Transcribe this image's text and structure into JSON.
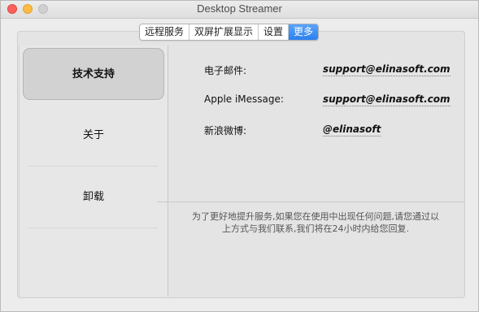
{
  "window": {
    "title": "Desktop Streamer"
  },
  "tabs": [
    {
      "label": "远程服务"
    },
    {
      "label": "双屏扩展显示"
    },
    {
      "label": "设置"
    },
    {
      "label": "更多",
      "active": true
    }
  ],
  "sidebar": {
    "items": [
      {
        "label": "技术支持",
        "selected": true
      },
      {
        "label": "关于"
      },
      {
        "label": "卸载"
      }
    ]
  },
  "support": {
    "email_label": "电子邮件:",
    "email_value": "support@elinasoft.com",
    "imessage_label": "Apple iMessage:",
    "imessage_value": "support@elinasoft.com",
    "weibo_label": "新浪微博:",
    "weibo_value": "@elinasoft",
    "note_line1": "为了更好地提升服务,如果您在使用中出现任何问题,请您通过以",
    "note_line2": "上方式与我们联系,我们将在24小时内给您回复."
  },
  "colors": {
    "tab_active": "#2a7fef",
    "close": "#fc605c",
    "minimize": "#fdbc40"
  }
}
